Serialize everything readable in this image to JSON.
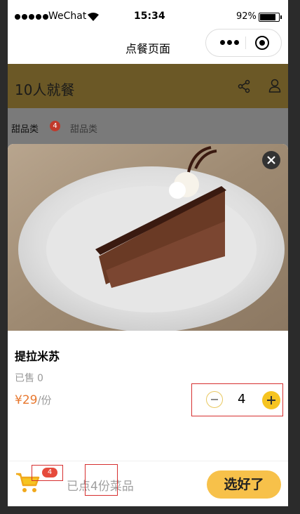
{
  "status_bar": {
    "carrier": "WeChat",
    "time": "15:34",
    "battery": "92%"
  },
  "nav": {
    "title": "点餐页面"
  },
  "page_header": {
    "title": "10人就餐"
  },
  "category_tabs": {
    "tab_1": "甜品类",
    "tab_1_badge": "4",
    "tab_2": "甜品类"
  },
  "dish": {
    "name": "提拉米苏",
    "sold_label": "已售",
    "sold_count": "0",
    "price": "¥29",
    "unit": "/份",
    "quantity": "4"
  },
  "cart": {
    "badge": "4",
    "ordered_prefix": "已点",
    "ordered_count": "4",
    "ordered_suffix": "份菜品",
    "done_label": "选好了"
  },
  "colors": {
    "header_band": "#6b5826",
    "price": "#e8782f",
    "accent_yellow": "#f6c421",
    "badge_red": "#e64b3c"
  },
  "icons": [
    "wifi-icon",
    "share-icon",
    "user-icon",
    "close-icon",
    "minus-icon",
    "plus-icon",
    "cart-icon"
  ]
}
